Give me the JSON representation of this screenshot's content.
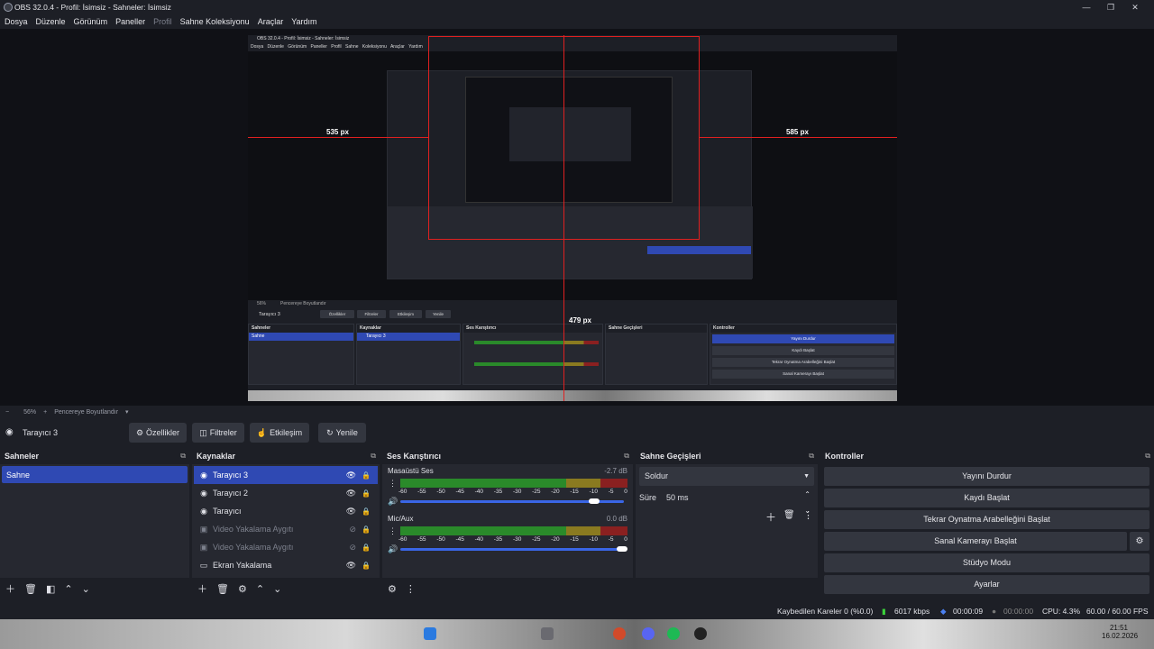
{
  "window": {
    "title": "OBS 32.0.4 - Profil: İsimsiz - Sahneler: İsimsiz"
  },
  "menu": [
    "Dosya",
    "Düzenle",
    "Görünüm",
    "Paneller",
    "Profil",
    "Sahne Koleksiyonu",
    "Araçlar",
    "Yardım"
  ],
  "preview": {
    "inner_title": "OBS 32.0.4 - Profil: İsimsiz - Sahneler: İsimsiz",
    "inner_menu": "Dosya Düzenle Görünüm Paneller Profil Sahne Koleksiyonu Araçlar Yardım",
    "measure_left": "535 px",
    "measure_right": "585 px",
    "measure_bottom": "479 px",
    "inner_zoom": "56%",
    "inner_fit": "Pencereye Boyutlandır",
    "inner_source": "Tarayıcı 3",
    "inner_btns": [
      "Özellikler",
      "Filtreler",
      "Etkileşim",
      "Yenile"
    ],
    "inner_panels": [
      "Sahneler",
      "Kaynaklar",
      "Ses Karıştırıcı",
      "Sahne Geçişleri",
      "Kontroller"
    ],
    "inner_ctrls": [
      "Yayını Durdur",
      "Kaydı Başlat",
      "Tekrar Oynatma Arabelleğini Başlat",
      "Sanal Kamerayı Başlat",
      "Stüdyo Modu",
      "Ayarlar"
    ]
  },
  "zoom": {
    "minus": "−",
    "value": "56%",
    "plus": "+",
    "fit": "Pencereye Boyutlandır",
    "arrow": "▾"
  },
  "source_bar": {
    "current": "Tarayıcı 3",
    "properties": "Özellikler",
    "filters": "Filtreler",
    "interact": "Etkileşim",
    "refresh": "Yenile"
  },
  "scenes": {
    "title": "Sahneler",
    "items": [
      "Sahne"
    ]
  },
  "sources": {
    "title": "Kaynaklar",
    "items": [
      {
        "label": "Tarayıcı 3",
        "selected": true,
        "hidden": false
      },
      {
        "label": "Tarayıcı 2",
        "selected": false,
        "hidden": false
      },
      {
        "label": "Tarayıcı",
        "selected": false,
        "hidden": false
      },
      {
        "label": "Video Yakalama Aygıtı",
        "selected": false,
        "hidden": true
      },
      {
        "label": "Video Yakalama Aygıtı",
        "selected": false,
        "hidden": true
      },
      {
        "label": "Ekran Yakalama",
        "selected": false,
        "hidden": false
      }
    ]
  },
  "mixer": {
    "title": "Ses Karıştırıcı",
    "channels": [
      {
        "name": "Masaüstü Ses",
        "db": "-2.7 dB",
        "volume": 0.95
      },
      {
        "name": "Mic/Aux",
        "db": "0.0 dB",
        "volume": 1.0
      }
    ],
    "ticks": [
      "-60",
      "-55",
      "-50",
      "-45",
      "-40",
      "-35",
      "-30",
      "-25",
      "-20",
      "-15",
      "-10",
      "-5",
      "0"
    ]
  },
  "transitions": {
    "title": "Sahne Geçişleri",
    "selected": "Soldur",
    "duration_label": "Süre",
    "duration": "50 ms"
  },
  "controls": {
    "title": "Kontroller",
    "stream": "Yayını Durdur",
    "record": "Kaydı Başlat",
    "replay": "Tekrar Oynatma Arabelleğini Başlat",
    "virtualcam": "Sanal Kamerayı Başlat",
    "studio": "Stüdyo Modu",
    "settings": "Ayarlar"
  },
  "status": {
    "dropped": "Kaybedilen Kareler 0 (%0.0)",
    "bitrate": "6017 kbps",
    "stream_time": "00:00:09",
    "rec_time": "00:00:00",
    "cpu": "CPU: 4.3%",
    "fps": "60.00 / 60.00 FPS"
  },
  "clock": {
    "time": "21:51",
    "date": "16.02.2026"
  },
  "colors": {
    "accent": "#2f49b3",
    "measure": "#e02020"
  }
}
